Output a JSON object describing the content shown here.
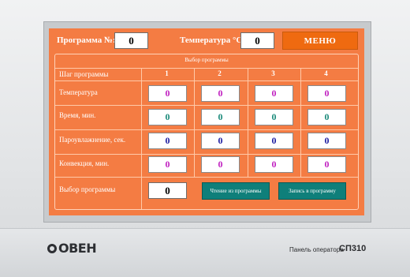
{
  "header": {
    "program_label": "Программа №:",
    "program_value": "0",
    "temperature_label": "Температура °С:",
    "temperature_value": "0",
    "menu_label": "МЕНЮ"
  },
  "panel": {
    "title": "Выбор программы",
    "step_label": "Шаг программы",
    "columns": [
      "1",
      "2",
      "3",
      "4"
    ],
    "rows": [
      {
        "label": "Температура",
        "values": [
          "0",
          "0",
          "0",
          "0"
        ],
        "color": "#c020c0"
      },
      {
        "label": "Время, мин.",
        "values": [
          "0",
          "0",
          "0",
          "0"
        ],
        "color": "#1a8a7a"
      },
      {
        "label": "Пароувлажнение, сек.",
        "values": [
          "0",
          "0",
          "0",
          "0"
        ],
        "color": "#1a1aa0"
      },
      {
        "label": "Конвекция, мин.",
        "values": [
          "0",
          "0",
          "0",
          "0"
        ],
        "color": "#c020c0"
      }
    ],
    "select_label": "Выбор программы",
    "select_value": "0",
    "read_button": "Чтение из программы",
    "write_button": "Запись в программу"
  },
  "device": {
    "logo": "ОВЕН",
    "caption_prefix": "Панель оператора",
    "caption_model": "СП310"
  },
  "colors": {
    "screen_bg": "#f47c43",
    "menu_button": "#ef6a10",
    "action_button": "#0f7f7a"
  }
}
